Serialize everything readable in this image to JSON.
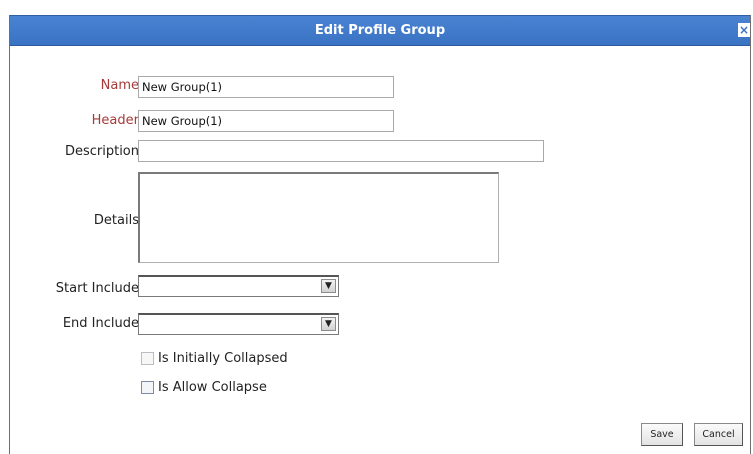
{
  "dialog": {
    "title": "Edit Profile Group",
    "close_glyph": "×"
  },
  "form": {
    "name": {
      "label": "Name",
      "value": "New Group(1)"
    },
    "header": {
      "label": "Header",
      "value": "New Group(1)"
    },
    "description": {
      "label": "Description",
      "value": ""
    },
    "details": {
      "label": "Details",
      "value": ""
    },
    "start_include": {
      "label": "Start Include",
      "selected": ""
    },
    "end_include": {
      "label": "End Include",
      "selected": ""
    },
    "is_initially_collapsed": {
      "label": "Is Initially Collapsed",
      "checked": false,
      "enabled": false
    },
    "is_allow_collapse": {
      "label": "Is Allow Collapse",
      "checked": false,
      "enabled": true
    }
  },
  "buttons": {
    "save": "Save",
    "cancel": "Cancel"
  },
  "icons": {
    "dropdown": "chevron-down-icon",
    "close": "close-icon"
  },
  "colors": {
    "titlebar": "#3b73c4",
    "required_label": "#a63a3a"
  }
}
